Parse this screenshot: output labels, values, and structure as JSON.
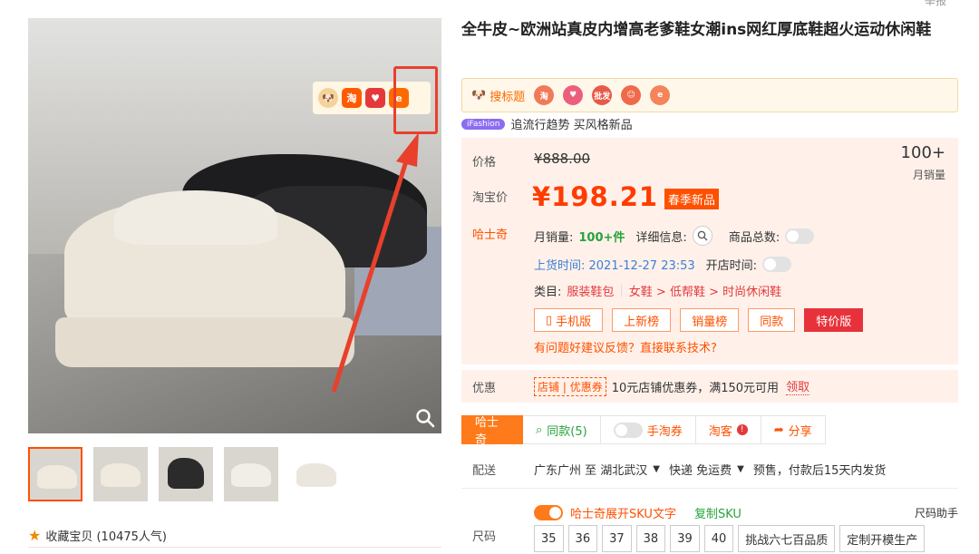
{
  "header": {
    "top_right": "举报"
  },
  "gallery": {
    "badges": [
      "dog",
      "淘",
      "heart",
      "ali"
    ],
    "thumbs_count": 5,
    "favorite": "收藏宝贝 (10475人气)"
  },
  "product": {
    "title": "全牛皮~欧洲站真皮内增高老爹鞋女潮ins网红厚底鞋超火运动休闲鞋"
  },
  "ext_bar": {
    "search_title": "搜标题",
    "icons": [
      "淘",
      "heart",
      "批发",
      "smile",
      "ali"
    ]
  },
  "fashion": {
    "tag": "iFashion",
    "text": "追流行趋势 买风格新品"
  },
  "price": {
    "price_label": "价格",
    "original": "¥888.00",
    "sales_num": "100+",
    "sales_label": "月销量",
    "tb_label": "淘宝价",
    "tb_price": "¥198.21",
    "badge": "春季新品"
  },
  "hsq": {
    "label": "哈士奇",
    "monthly_label": "月销量:",
    "monthly_value": "100+件",
    "detail_label": "详细信息:",
    "total_label": "商品总数:",
    "listed": "上货时间: 2021-12-27 23:53",
    "shop_time_label": "开店时间:",
    "cat_label": "类目:",
    "cat_1": "服装鞋包",
    "cat_2": "女鞋 > 低帮鞋 > 时尚休闲鞋",
    "buttons": [
      "手机版",
      "上新榜",
      "销量榜",
      "同款",
      "特价版"
    ],
    "feedback": "有问题好建议反馈？直接联系技术?"
  },
  "coupon": {
    "label": "优惠",
    "tag1": "店铺",
    "tag2": "优惠券",
    "text": "10元店铺优惠券，满150元可用",
    "get": "领取"
  },
  "tabs": {
    "hsq": "哈士奇",
    "same": "同款(5)",
    "taoquan": "手淘券",
    "taoke": "淘客",
    "share": "分享"
  },
  "shipping": {
    "label": "配送",
    "from": "广东广州 至  湖北武汉",
    "method": "快递 免运费",
    "note": "预售，付款后15天内发货"
  },
  "sku": {
    "expand": "哈士奇展开SKU文字",
    "copy": "复制SKU",
    "help": "尺码助手",
    "size_label": "尺码",
    "sizes": [
      "35",
      "36",
      "37",
      "38",
      "39",
      "40",
      "挑战六七百品质",
      "定制开模生产"
    ]
  }
}
